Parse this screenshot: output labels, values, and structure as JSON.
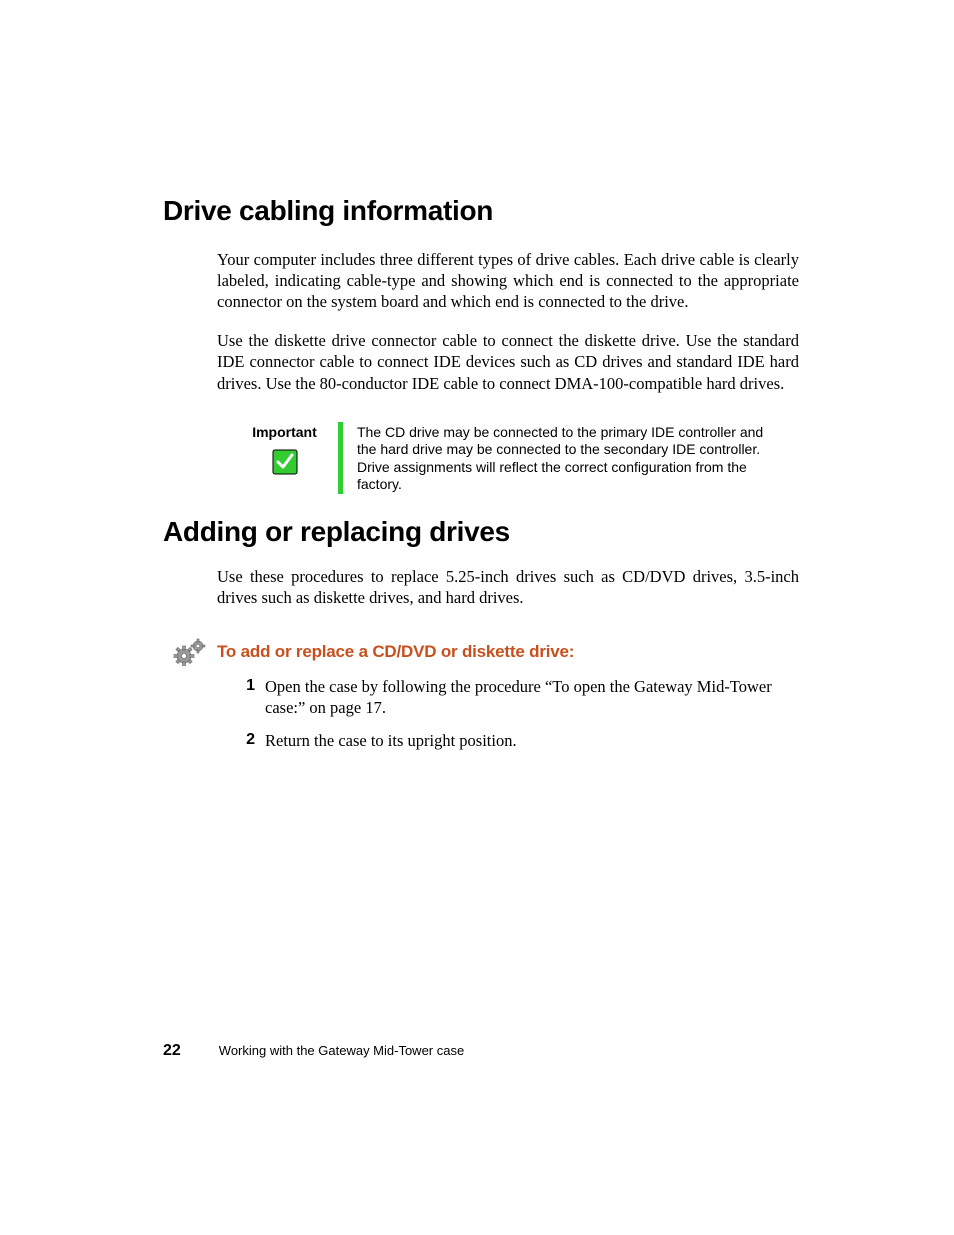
{
  "headings": {
    "h1_cabling": "Drive cabling information",
    "h1_adding": "Adding or replacing drives"
  },
  "paragraphs": {
    "cabling_p1": "Your computer includes three different types of drive cables. Each drive cable is clearly labeled, indicating cable-type and showing which end is connected to the appropriate connector on the system board and which end is connected to the drive.",
    "cabling_p2": "Use the diskette drive connector cable to connect the diskette drive. Use the standard IDE connector cable to connect IDE devices such as CD drives and standard IDE hard drives. Use the 80-conductor IDE cable to connect DMA-100-compatible hard drives.",
    "adding_p1": "Use these procedures to replace 5.25-inch drives such as CD/DVD drives, 3.5-inch drives such as diskette drives, and hard drives."
  },
  "callout": {
    "label": "Important",
    "body": "The CD drive may be connected to the primary IDE controller and the hard drive may be connected to the secondary IDE controller. Drive assignments will reflect the correct configuration from the factory."
  },
  "procedure": {
    "heading": "To add or replace a CD/DVD or diskette drive:",
    "steps": [
      {
        "num": "1",
        "text": "Open the case by following the procedure “To open the Gateway Mid-Tower case:” on page 17."
      },
      {
        "num": "2",
        "text": "Return the case to its upright position."
      }
    ]
  },
  "footer": {
    "page_num": "22",
    "text": "Working with the Gateway Mid-Tower case"
  }
}
